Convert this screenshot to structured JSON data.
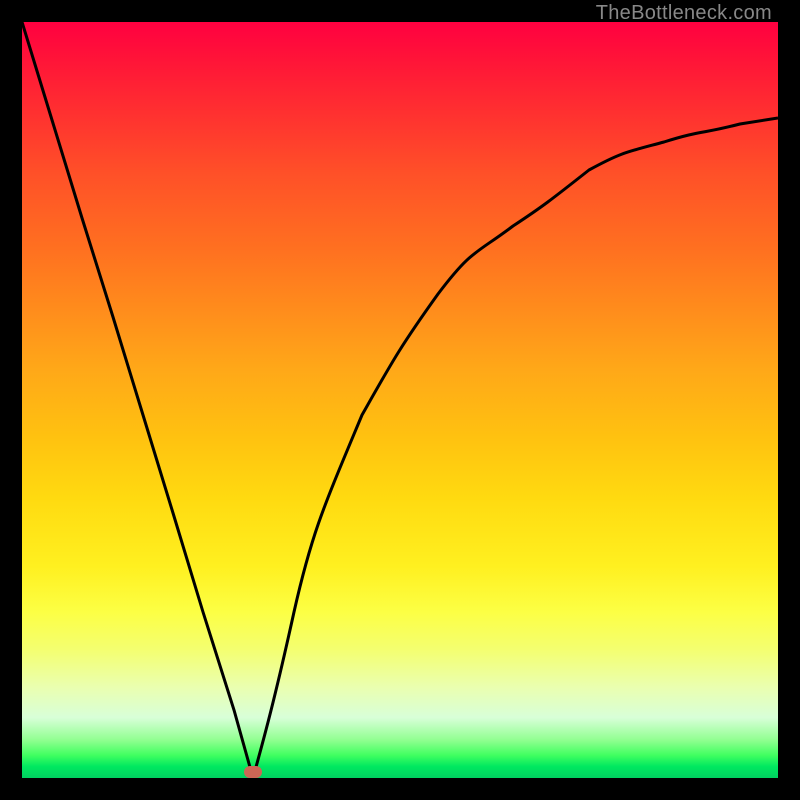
{
  "watermark": "TheBottleneck.com",
  "colors": {
    "frame": "#000000",
    "gradient_top": "#ff0040",
    "gradient_bottom": "#00d060",
    "curve": "#000000",
    "marker": "#cc6655"
  },
  "chart_data": {
    "type": "line",
    "title": "",
    "xlabel": "",
    "ylabel": "",
    "xlim": [
      0,
      100
    ],
    "ylim": [
      0,
      100
    ],
    "series": [
      {
        "name": "bottleneck-curve",
        "x": [
          0,
          4,
          8,
          12,
          16,
          20,
          24,
          28,
          30.5,
          33,
          36,
          40,
          45,
          50,
          55,
          60,
          65,
          70,
          75,
          80,
          85,
          90,
          95,
          100
        ],
        "y": [
          100,
          87,
          74,
          61,
          48,
          35,
          22,
          9,
          0,
          8,
          22,
          36,
          48,
          57,
          64,
          69,
          73,
          76.5,
          79,
          81,
          82.8,
          84.2,
          85.5,
          86.5
        ]
      }
    ],
    "annotations": [
      {
        "name": "min-marker",
        "x": 30.5,
        "y": 0
      }
    ]
  }
}
